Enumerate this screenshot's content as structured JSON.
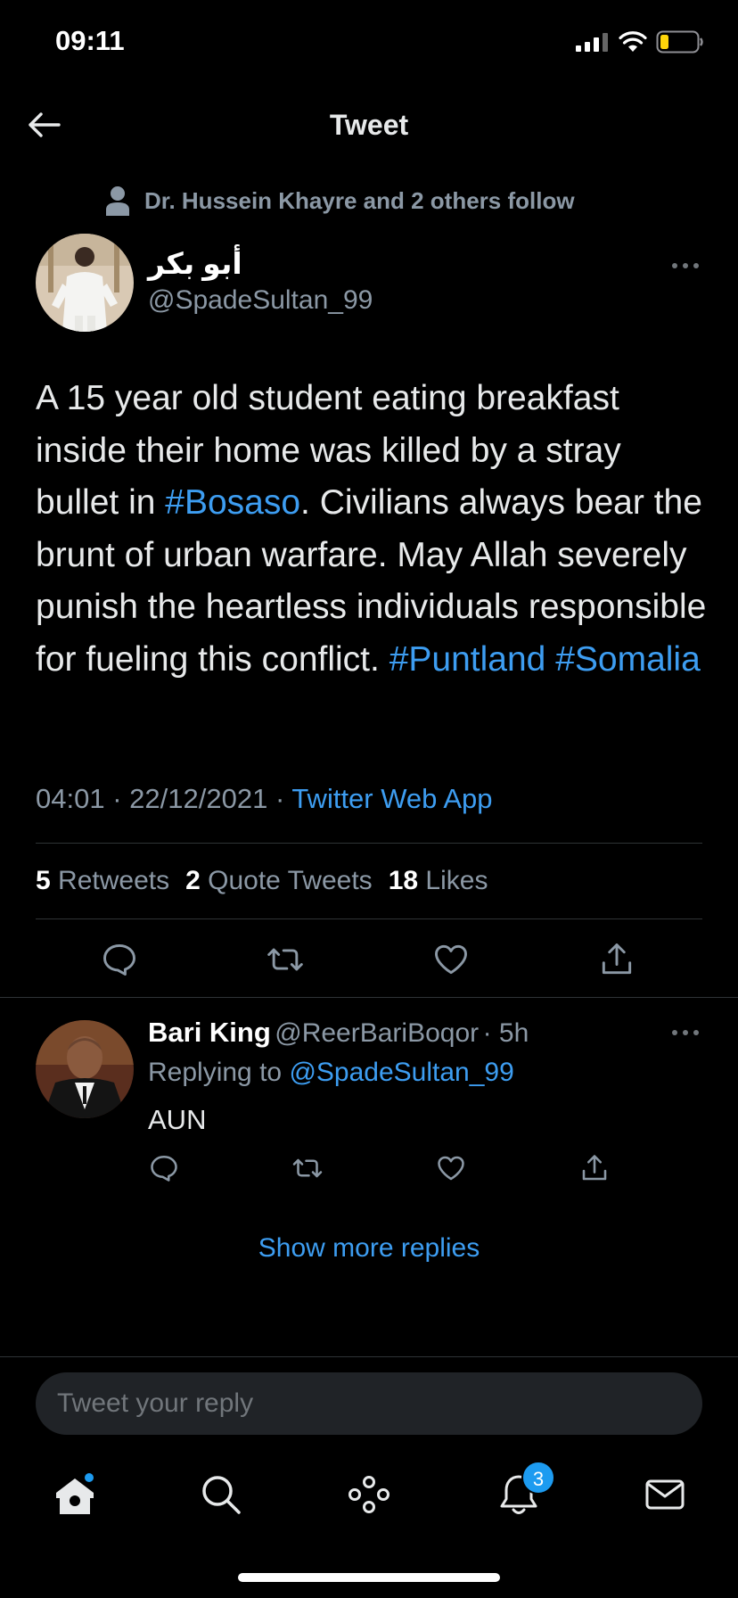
{
  "status_bar": {
    "time": "09:11"
  },
  "header": {
    "title": "Tweet"
  },
  "social_context": "Dr. Hussein Khayre and 2 others follow",
  "tweet": {
    "author_name": "أبو بكر",
    "author_handle": "@SpadeSultan_99",
    "text_parts": [
      "A 15 year old student eating breakfast inside their home was killed by a stray bullet in ",
      "#Bosaso",
      ". Civilians always bear the brunt of urban warfare. May Allah severely punish the heartless individuals responsible for fueling this conflict. ",
      "#Puntland",
      " ",
      "#Somalia"
    ],
    "time": "04:01",
    "date": "22/12/2021",
    "source": "Twitter Web App",
    "separator": "·",
    "retweets_count": "5",
    "retweets_label": "Retweets",
    "quotes_count": "2",
    "quotes_label": "Quote Tweets",
    "likes_count": "18",
    "likes_label": "Likes"
  },
  "reply": {
    "name": "Bari King",
    "handle": "@ReerBariBoqor",
    "age": "· 5h",
    "replying_label": "Replying to",
    "replying_handle": "@SpadeSultan_99",
    "text": "AUN"
  },
  "show_more": "Show more replies",
  "reply_input": {
    "placeholder": "Tweet your reply"
  },
  "tab_bar": {
    "notifications_badge": "3"
  },
  "colors": {
    "accent": "#1d9bf0",
    "link": "#3d9df1",
    "background": "#000000"
  }
}
